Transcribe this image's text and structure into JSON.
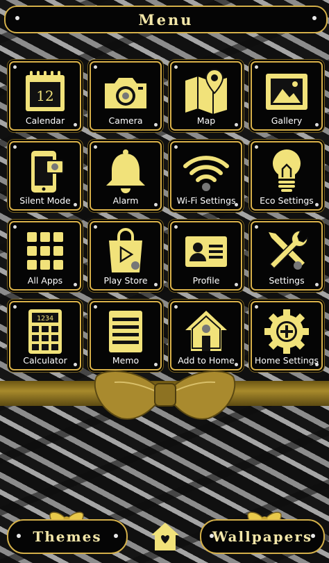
{
  "menu": {
    "title": "Menu"
  },
  "apps": [
    {
      "label": "Calendar",
      "icon": "calendar-icon",
      "day": "12"
    },
    {
      "label": "Camera",
      "icon": "camera-icon"
    },
    {
      "label": "Map",
      "icon": "map-icon"
    },
    {
      "label": "Gallery",
      "icon": "gallery-icon"
    },
    {
      "label": "Silent Mode",
      "icon": "silent-mode-icon"
    },
    {
      "label": "Alarm",
      "icon": "alarm-bell-icon"
    },
    {
      "label": "Wi-Fi Settings",
      "icon": "wifi-icon"
    },
    {
      "label": "Eco Settings",
      "icon": "lightbulb-icon"
    },
    {
      "label": "All Apps",
      "icon": "all-apps-grid-icon"
    },
    {
      "label": "Play Store",
      "icon": "play-store-bag-icon"
    },
    {
      "label": "Profile",
      "icon": "profile-card-icon"
    },
    {
      "label": "Settings",
      "icon": "wrench-screwdriver-icon"
    },
    {
      "label": "Calculator",
      "icon": "calculator-icon",
      "display": "1234"
    },
    {
      "label": "Memo",
      "icon": "memo-icon"
    },
    {
      "label": "Add to Home",
      "icon": "house-icon"
    },
    {
      "label": "Home Settings",
      "icon": "gear-plus-icon"
    }
  ],
  "bottom": {
    "themes_label": "Themes",
    "wallpapers_label": "Wallpapers"
  },
  "colors": {
    "gold": "#d9b14a",
    "icon_gold": "#f1e27a",
    "tile_bg": "#050505"
  }
}
